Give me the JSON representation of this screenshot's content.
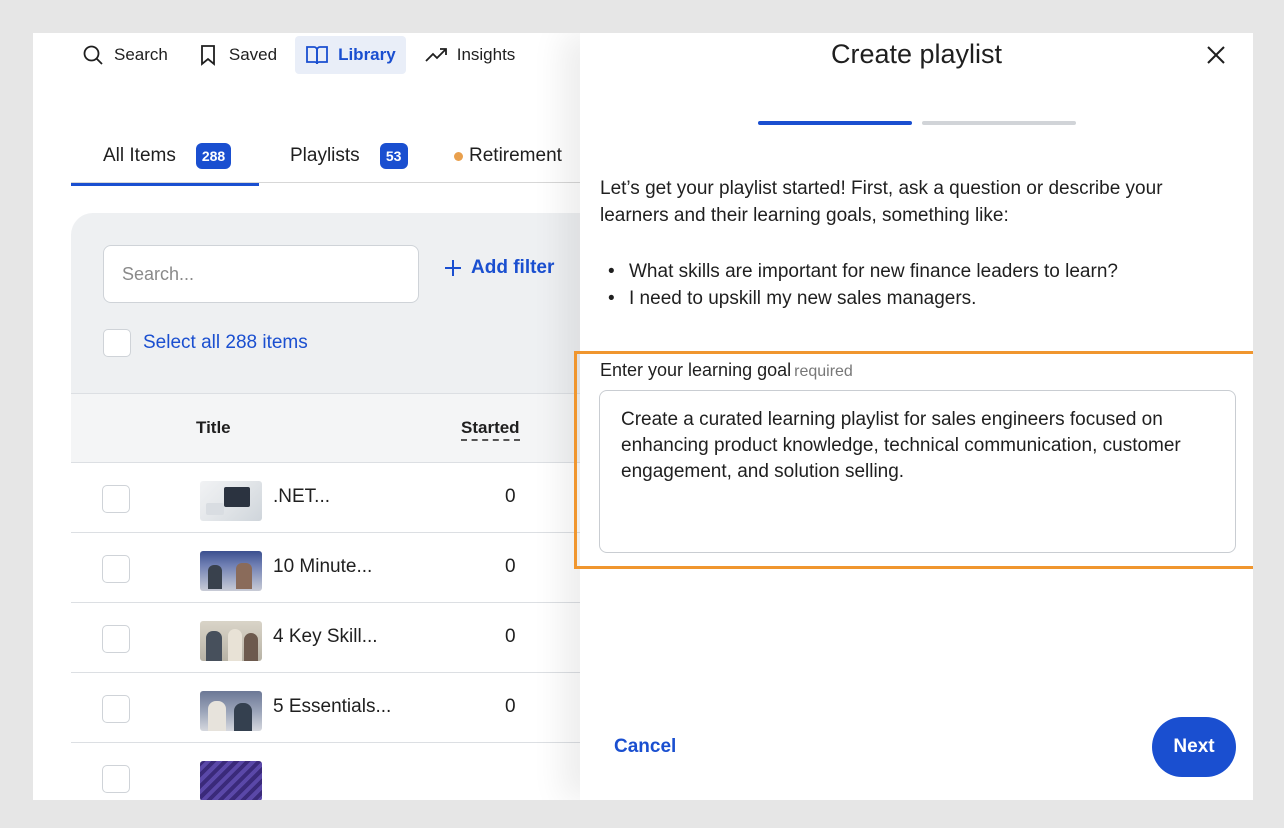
{
  "nav": {
    "items": [
      {
        "label": "Search",
        "icon": "search-icon"
      },
      {
        "label": "Saved",
        "icon": "bookmark-icon"
      },
      {
        "label": "Library",
        "icon": "book-icon",
        "active": true
      },
      {
        "label": "Insights",
        "icon": "trending-up-icon"
      }
    ]
  },
  "tabs": [
    {
      "label": "All Items",
      "count": "288",
      "active": true
    },
    {
      "label": "Playlists",
      "count": "53"
    },
    {
      "label": "Retirement"
    }
  ],
  "library": {
    "search_placeholder": "Search...",
    "add_filter_label": "Add filter",
    "select_all_label": "Select all 288 items",
    "columns": {
      "title": "Title",
      "started": "Started"
    },
    "rows": [
      {
        "title": ".NET...",
        "started": "0"
      },
      {
        "title": "10 Minute...",
        "started": "0"
      },
      {
        "title": "4 Key Skill...",
        "started": "0"
      },
      {
        "title": "5 Essentials...",
        "started": "0"
      }
    ]
  },
  "dialog": {
    "title": "Create playlist",
    "steps": {
      "current": 1,
      "total": 2
    },
    "intro": "Let’s get your playlist started! First, ask a question or describe your learners and their learning goals, something like:",
    "examples": [
      "What skills are important for new finance leaders to learn?",
      "I need to upskill my new sales managers."
    ],
    "goal_label": "Enter your learning goal",
    "goal_required": "required",
    "goal_value": "Create a curated learning playlist for sales engineers focused on enhancing product knowledge, technical communication, customer engagement, and solution selling.",
    "cancel_label": "Cancel",
    "next_label": "Next"
  },
  "colors": {
    "accent": "#1a4fd0",
    "highlight_border": "#f0962e",
    "tab_dot": "#e9a04d"
  }
}
